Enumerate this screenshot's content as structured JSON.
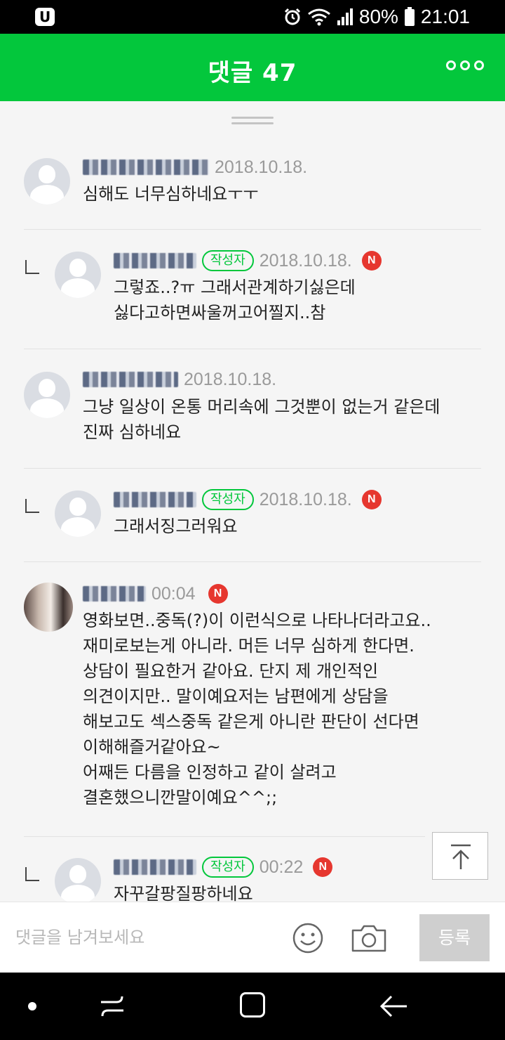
{
  "status_bar": {
    "battery": "80%",
    "time": "21:01"
  },
  "header": {
    "title": "댓글 47"
  },
  "comments": [
    {
      "date": "2018.10.18.",
      "text": "심해도 너무심하네요ㅜㅜ"
    },
    {
      "author_badge": "작성자",
      "date": "2018.10.18.",
      "new_badge": "N",
      "text": "그렇죠..?ㅠ 그래서관계하기싫은데\n싫다고하면싸울꺼고어찔지..참"
    },
    {
      "date": "2018.10.18.",
      "text": "그냥 일상이 온통 머리속에 그것뿐이 없는거 같은데\n진짜 심하네요"
    },
    {
      "author_badge": "작성자",
      "date": "2018.10.18.",
      "new_badge": "N",
      "text": "그래서징그러워요"
    },
    {
      "date": "00:04",
      "new_badge": "N",
      "text": "영화보면..중독(?)이 이런식으로 나타나더라고요..\n재미로보는게 아니라. 머든 너무 심하게 한다면.\n상담이 필요한거 같아요. 단지 제 개인적인\n의견이지만.. 말이예요저는 남편에게 상담을\n해보고도 섹스중독 같은게 아니란 판단이 선다면\n이해해즐거같아요~\n어째든 다름을 인정하고 같이 살려고\n결혼했으니깐말이예요^^;;"
    },
    {
      "author_badge": "작성자",
      "date": "00:22",
      "new_badge": "N",
      "text": "자꾸갈팡질팡하네요"
    }
  ],
  "input": {
    "placeholder": "댓글을 남겨보세요",
    "submit_label": "등록"
  },
  "icons": {
    "header_more": "more-dots-icon",
    "emoji": "smiley-icon",
    "camera": "camera-icon",
    "scroll_top": "arrow-up-to-top-icon"
  },
  "colors": {
    "brand": "#03c73c",
    "new_badge": "#e6372f"
  }
}
